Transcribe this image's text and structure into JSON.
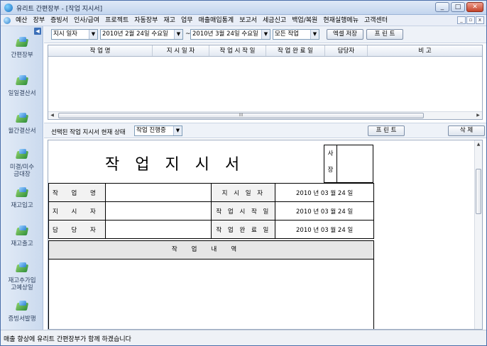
{
  "window": {
    "title": "유리트 간편장부 - [작업 지시서]",
    "controls": [
      "_",
      "□",
      "✕"
    ]
  },
  "menubar": {
    "items": [
      "예산",
      "장부",
      "증빙서",
      "인사/급여",
      "프로젝트",
      "자동장부",
      "재고",
      "업무",
      "매출매입통계",
      "보고서",
      "세금신고",
      "백업/복원",
      "현재실행메뉴",
      "고객센터"
    ],
    "mdi_controls": [
      "_",
      "▫",
      "x"
    ]
  },
  "sidebar": {
    "collapse_glyph": "◀",
    "items": [
      {
        "label": "간편장부",
        "icon": "ledger-icon"
      },
      {
        "label": "일일결산서",
        "icon": "daily-settlement-icon"
      },
      {
        "label": "월간결산서",
        "icon": "monthly-settlement-icon"
      },
      {
        "label": "미결/미수\n금대장",
        "icon": "receivables-icon"
      },
      {
        "label": "재고입고",
        "icon": "stock-in-icon"
      },
      {
        "label": "재고출고",
        "icon": "stock-out-icon"
      },
      {
        "label": "재고추가입\n고예상일",
        "icon": "stock-plan-icon"
      },
      {
        "label": "증빙서발행",
        "icon": "voucher-issue-icon"
      }
    ]
  },
  "filters": {
    "date_type": "지시 일자",
    "start_date": "2010년  2월 24일 수요일",
    "tilde": "~",
    "end_date": "2010년  3월 24일 수요일",
    "status": "모든 작업",
    "excel_button": "엑셀 저장",
    "print_button": "프 린 트"
  },
  "grid": {
    "columns": [
      "작   업   명",
      "지 시 일 자",
      "작 업 시 작 일",
      "작 업 완 료 일",
      "담당자",
      "비       고"
    ],
    "scroll_thumb_mark": "III"
  },
  "state_bar": {
    "label": "선택된 작업 지시서 현재 상태",
    "value": "작업 진행중",
    "print_button": "프 린 트",
    "delete_button": "삭 제"
  },
  "document": {
    "title": "작업지시서",
    "approval": [
      "사",
      "장"
    ],
    "rows": [
      {
        "label": "작 업 명",
        "value": "",
        "label2": "지 시 일 자",
        "value2": "2010 년  03 월  24 일"
      },
      {
        "label": "지 시 자",
        "value": "",
        "label2": "작 업 시 작 일",
        "value2": "2010 년  03 월  24 일"
      },
      {
        "label": "담 당 자",
        "value": "",
        "label2": "작 업 완 료 일",
        "value2": "2010 년  03 월  24 일"
      }
    ],
    "content_header": "작업내역"
  },
  "status": {
    "message": "매출 향상에 유리트 간편장부가 함께 하겠습니다"
  }
}
